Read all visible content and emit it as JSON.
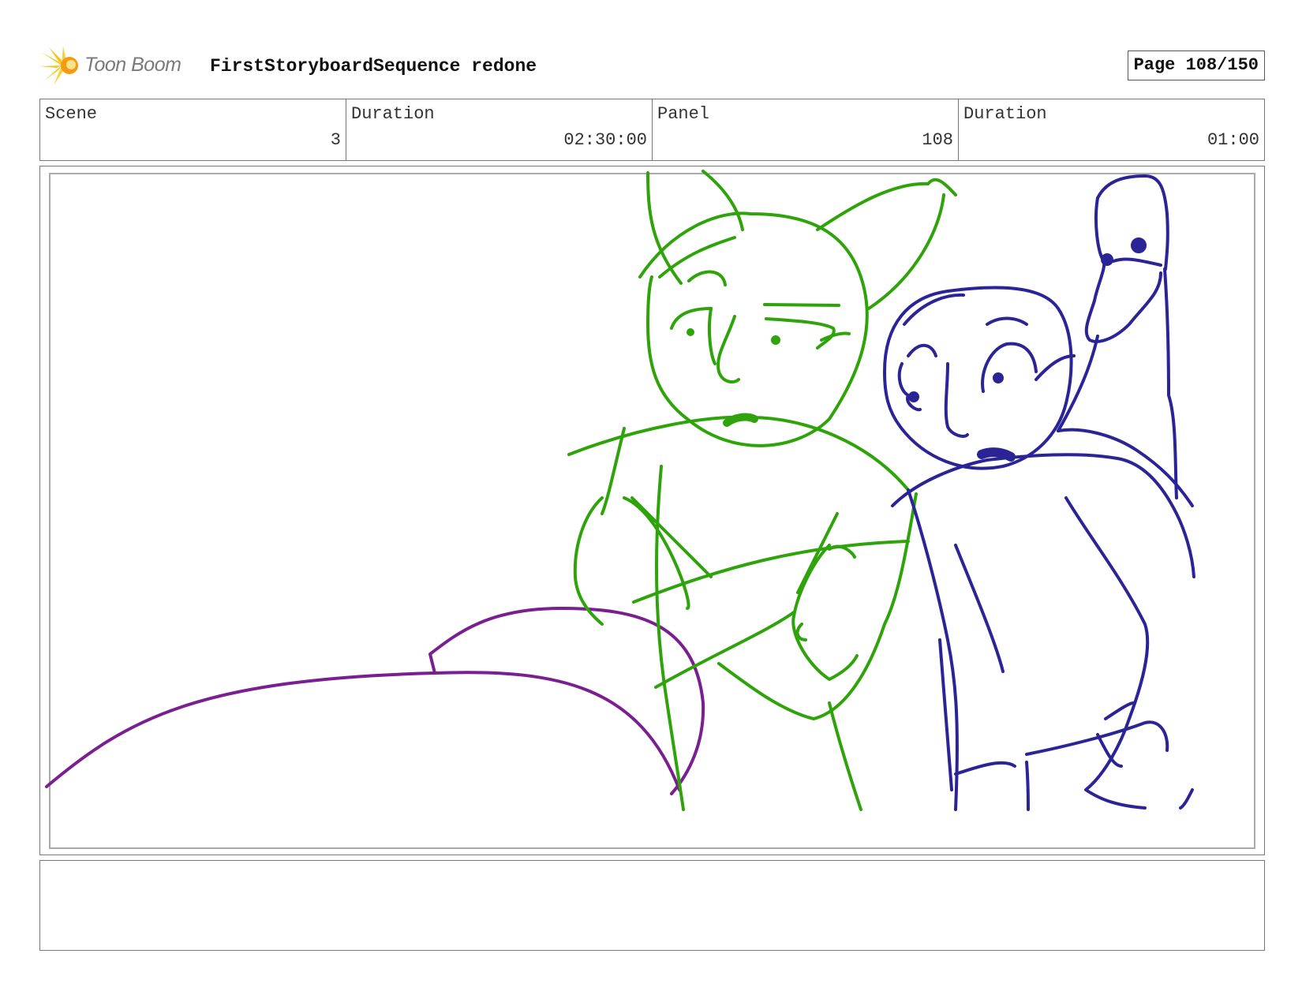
{
  "header": {
    "logo_text": "Toon Boom",
    "project_title": "FirstStoryboardSequence redone",
    "page_label": "Page 108/150"
  },
  "info": {
    "scene_label": "Scene",
    "scene_value": "3",
    "scene_duration_label": "Duration",
    "scene_duration_value": "02:30:00",
    "panel_label": "Panel",
    "panel_value": "108",
    "panel_duration_label": "Duration",
    "panel_duration_value": "01:00"
  },
  "notes": {
    "text": ""
  },
  "colors": {
    "logo_yellow": "#f5c518",
    "logo_orange": "#f39c12",
    "sketch_green": "#2ea30a",
    "sketch_blue": "#2a2496",
    "sketch_purple": "#7a1f8f"
  }
}
